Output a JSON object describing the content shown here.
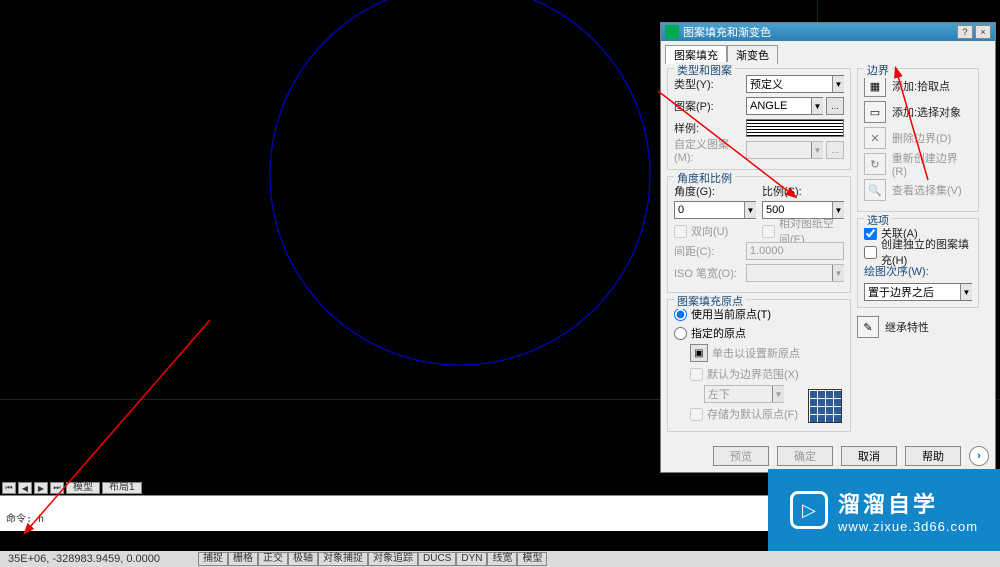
{
  "dialog": {
    "title": "图案填充和渐变色",
    "tabs": {
      "hatch": "图案填充",
      "gradient": "渐变色"
    },
    "type_pattern": {
      "group": "类型和图案",
      "type_label": "类型(Y):",
      "type_value": "预定义",
      "pattern_label": "图案(P):",
      "pattern_value": "ANGLE",
      "sample_label": "样例:",
      "custom_label": "自定义图案(M):"
    },
    "angle_scale": {
      "group": "角度和比例",
      "angle_label": "角度(G):",
      "angle_value": "0",
      "scale_label": "比例(S):",
      "scale_value": "500",
      "double": "双向(U)",
      "paper": "相对图纸空间(E)",
      "spacing_label": "间距(C):",
      "spacing_value": "1.0000",
      "iso_label": "ISO 笔宽(O):"
    },
    "origin": {
      "group": "图案填充原点",
      "use_current": "使用当前原点(T)",
      "specified": "指定的原点",
      "click_set": "单击以设置新原点",
      "default_ext": "默认为边界范围(X)",
      "pos_value": "左下",
      "save_default": "存储为默认原点(F)"
    },
    "boundary": {
      "group": "边界",
      "pick": "添加:拾取点",
      "select": "添加:选择对象",
      "remove": "删除边界(D)",
      "recreate": "重新创建边界(R)",
      "view": "查看选择集(V)"
    },
    "options": {
      "group": "选项",
      "assoc": "关联(A)",
      "separate": "创建独立的图案填充(H)",
      "order_label": "绘图次序(W):",
      "order_value": "置于边界之后"
    },
    "inherit": "继承特性",
    "buttons": {
      "preview": "预览",
      "ok": "确定",
      "cancel": "取消",
      "help": "帮助"
    }
  },
  "status": {
    "tabs": {
      "model": "模型",
      "layout1": "布局1"
    },
    "coords": "35E+06, -328983.9459, 0.0000",
    "snap": "捕捉",
    "grid": "栅格",
    "ortho": "正交",
    "polar": "极轴",
    "osnap": "对象捕捉",
    "otrack": "对象追踪",
    "ducs": "DUCS",
    "dyn": "DYN",
    "lwt": "线宽",
    "model_btn": "模型"
  },
  "cmd": {
    "prompt": "命令: h"
  },
  "watermark": {
    "brand": "溜溜自学",
    "url": "www.zixue.3d66.com"
  }
}
